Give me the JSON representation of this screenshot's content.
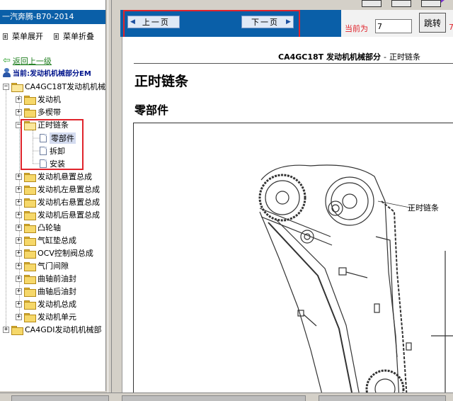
{
  "app": {
    "title": "一汽奔腾-B70-2014"
  },
  "sidebar": {
    "expand_label": "菜单展开",
    "collapse_label": "菜单折叠",
    "back_label": "返回上一级",
    "current_label": "当前:发动机机械部分EM",
    "tree": {
      "root_label": "CA4GC18T发动机机械",
      "items": [
        {
          "label": "发动机"
        },
        {
          "label": "多楔带"
        },
        {
          "label": "正时链条"
        },
        {
          "label": "发动机悬置总成"
        },
        {
          "label": "发动机左悬置总成"
        },
        {
          "label": "发动机右悬置总成"
        },
        {
          "label": "发动机后悬置总成"
        },
        {
          "label": "凸轮轴"
        },
        {
          "label": "气缸垫总成"
        },
        {
          "label": "OCV控制阀总成"
        },
        {
          "label": "气门间隙"
        },
        {
          "label": "曲轴前油封"
        },
        {
          "label": "曲轴后油封"
        },
        {
          "label": "发动机总成"
        },
        {
          "label": "发动机单元"
        }
      ],
      "children": [
        {
          "label": "零部件"
        },
        {
          "label": "拆卸"
        },
        {
          "label": "安装"
        }
      ],
      "second_root_label": "CA4GDI发动机机械部"
    }
  },
  "nav": {
    "prev_label": "上一页",
    "next_label": "下一页",
    "current_page_label": "当前为",
    "current_page_value": "7",
    "jump_label": "跳转",
    "total_pages_partial": "7"
  },
  "document": {
    "header_model": "CA4GC18T 发动机机械部分",
    "header_separator": "-",
    "header_section": "正时链条",
    "title": "正时链条",
    "subtitle": "零部件",
    "figure_callout": "正时链条"
  },
  "colors": {
    "nav_blue": "#0a5fa8",
    "highlight_red": "#e0242c",
    "link_green": "#1d7d1d",
    "current_blue": "#00148c"
  }
}
